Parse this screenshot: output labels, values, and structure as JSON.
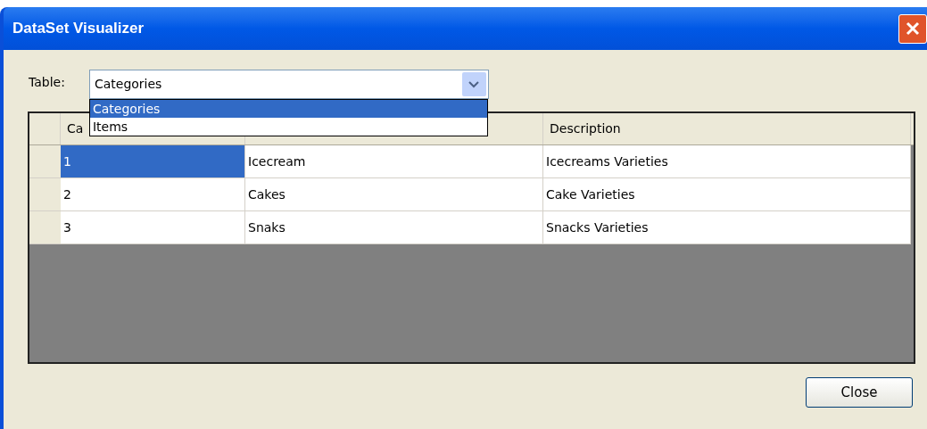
{
  "window": {
    "title": "DataSet Visualizer"
  },
  "table_selector": {
    "label": "Table:",
    "value": "Categories",
    "expanded": true,
    "options": [
      {
        "label": "Categories",
        "selected": true
      },
      {
        "label": "Items",
        "selected": false
      }
    ]
  },
  "grid": {
    "columns": [
      {
        "label": "Ca"
      },
      {},
      {
        "label": "Description"
      }
    ],
    "rows": [
      {
        "cells": [
          {
            "text": "1",
            "selected": true
          },
          {
            "text": "Icecream",
            "selected": false
          },
          {
            "text": "Icecreams Varieties",
            "selected": false
          }
        ]
      },
      {
        "cells": [
          {
            "text": "2",
            "selected": false
          },
          {
            "text": "Cakes",
            "selected": false
          },
          {
            "text": "Cake Varieties",
            "selected": false
          }
        ]
      },
      {
        "cells": [
          {
            "text": "3",
            "selected": false
          },
          {
            "text": "Snaks",
            "selected": false
          },
          {
            "text": "Snacks Varieties",
            "selected": false
          }
        ]
      }
    ]
  },
  "buttons": [
    {
      "label": "Close"
    }
  ]
}
